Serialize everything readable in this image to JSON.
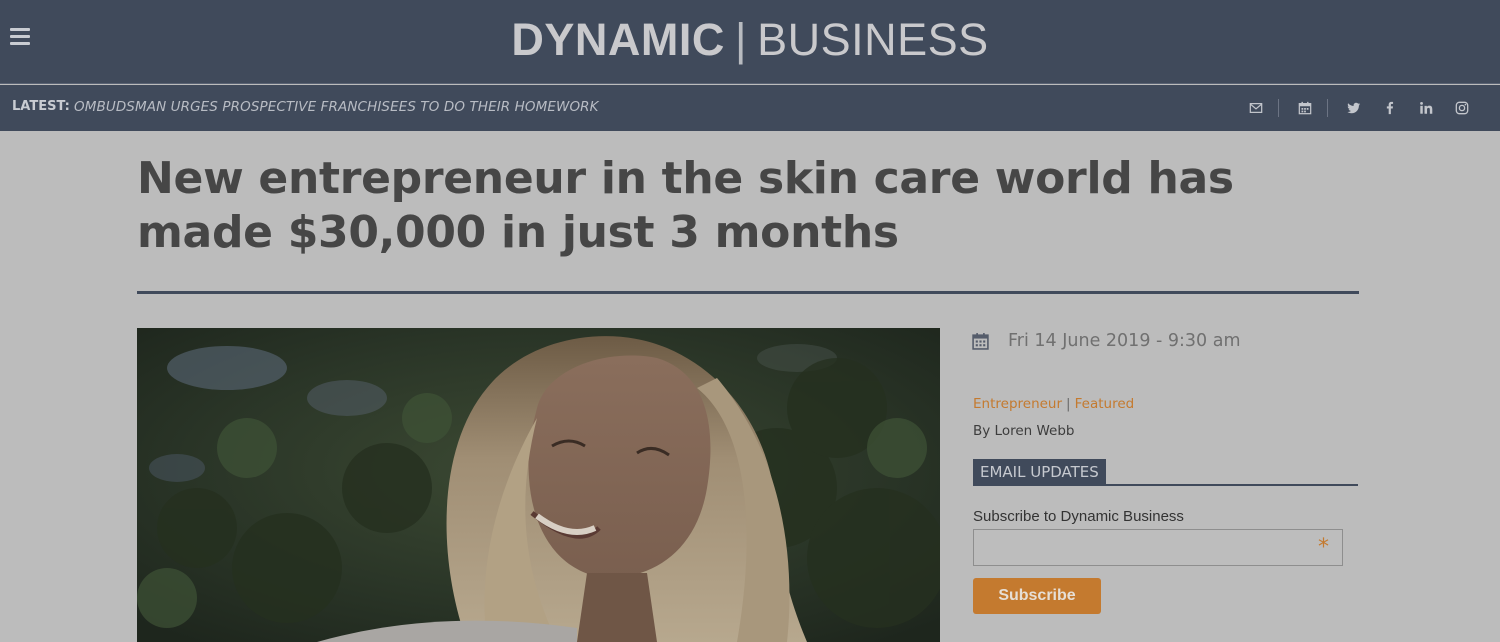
{
  "header": {
    "logo_primary": "DYNAMIC",
    "logo_separator": "|",
    "logo_secondary": "BUSINESS"
  },
  "latest": {
    "label": "LATEST:",
    "headline": "OMBUDSMAN URGES PROSPECTIVE FRANCHISEES TO DO THEIR HOMEWORK"
  },
  "social_icons": [
    "mail-icon",
    "calendar-icon",
    "twitter-icon",
    "facebook-icon",
    "linkedin-icon",
    "instagram-icon"
  ],
  "article": {
    "title": "New entrepreneur in the skin care world has made $30,000 in just 3 months",
    "date": "Fri 14 June 2019 - 9:30 am",
    "categories": [
      "Entrepreneur",
      "Featured"
    ],
    "category_separator": "|",
    "byline": "By Loren Webb"
  },
  "email_updates": {
    "heading": "EMAIL UPDATES",
    "label": "Subscribe to Dynamic Business",
    "input_value": "",
    "required_marker": "*",
    "button_label": "Subscribe"
  },
  "colors": {
    "header_bg": "#404a5b",
    "page_bg": "#bcbcbc",
    "accent": "#c47a2f",
    "title_text": "#464646"
  }
}
